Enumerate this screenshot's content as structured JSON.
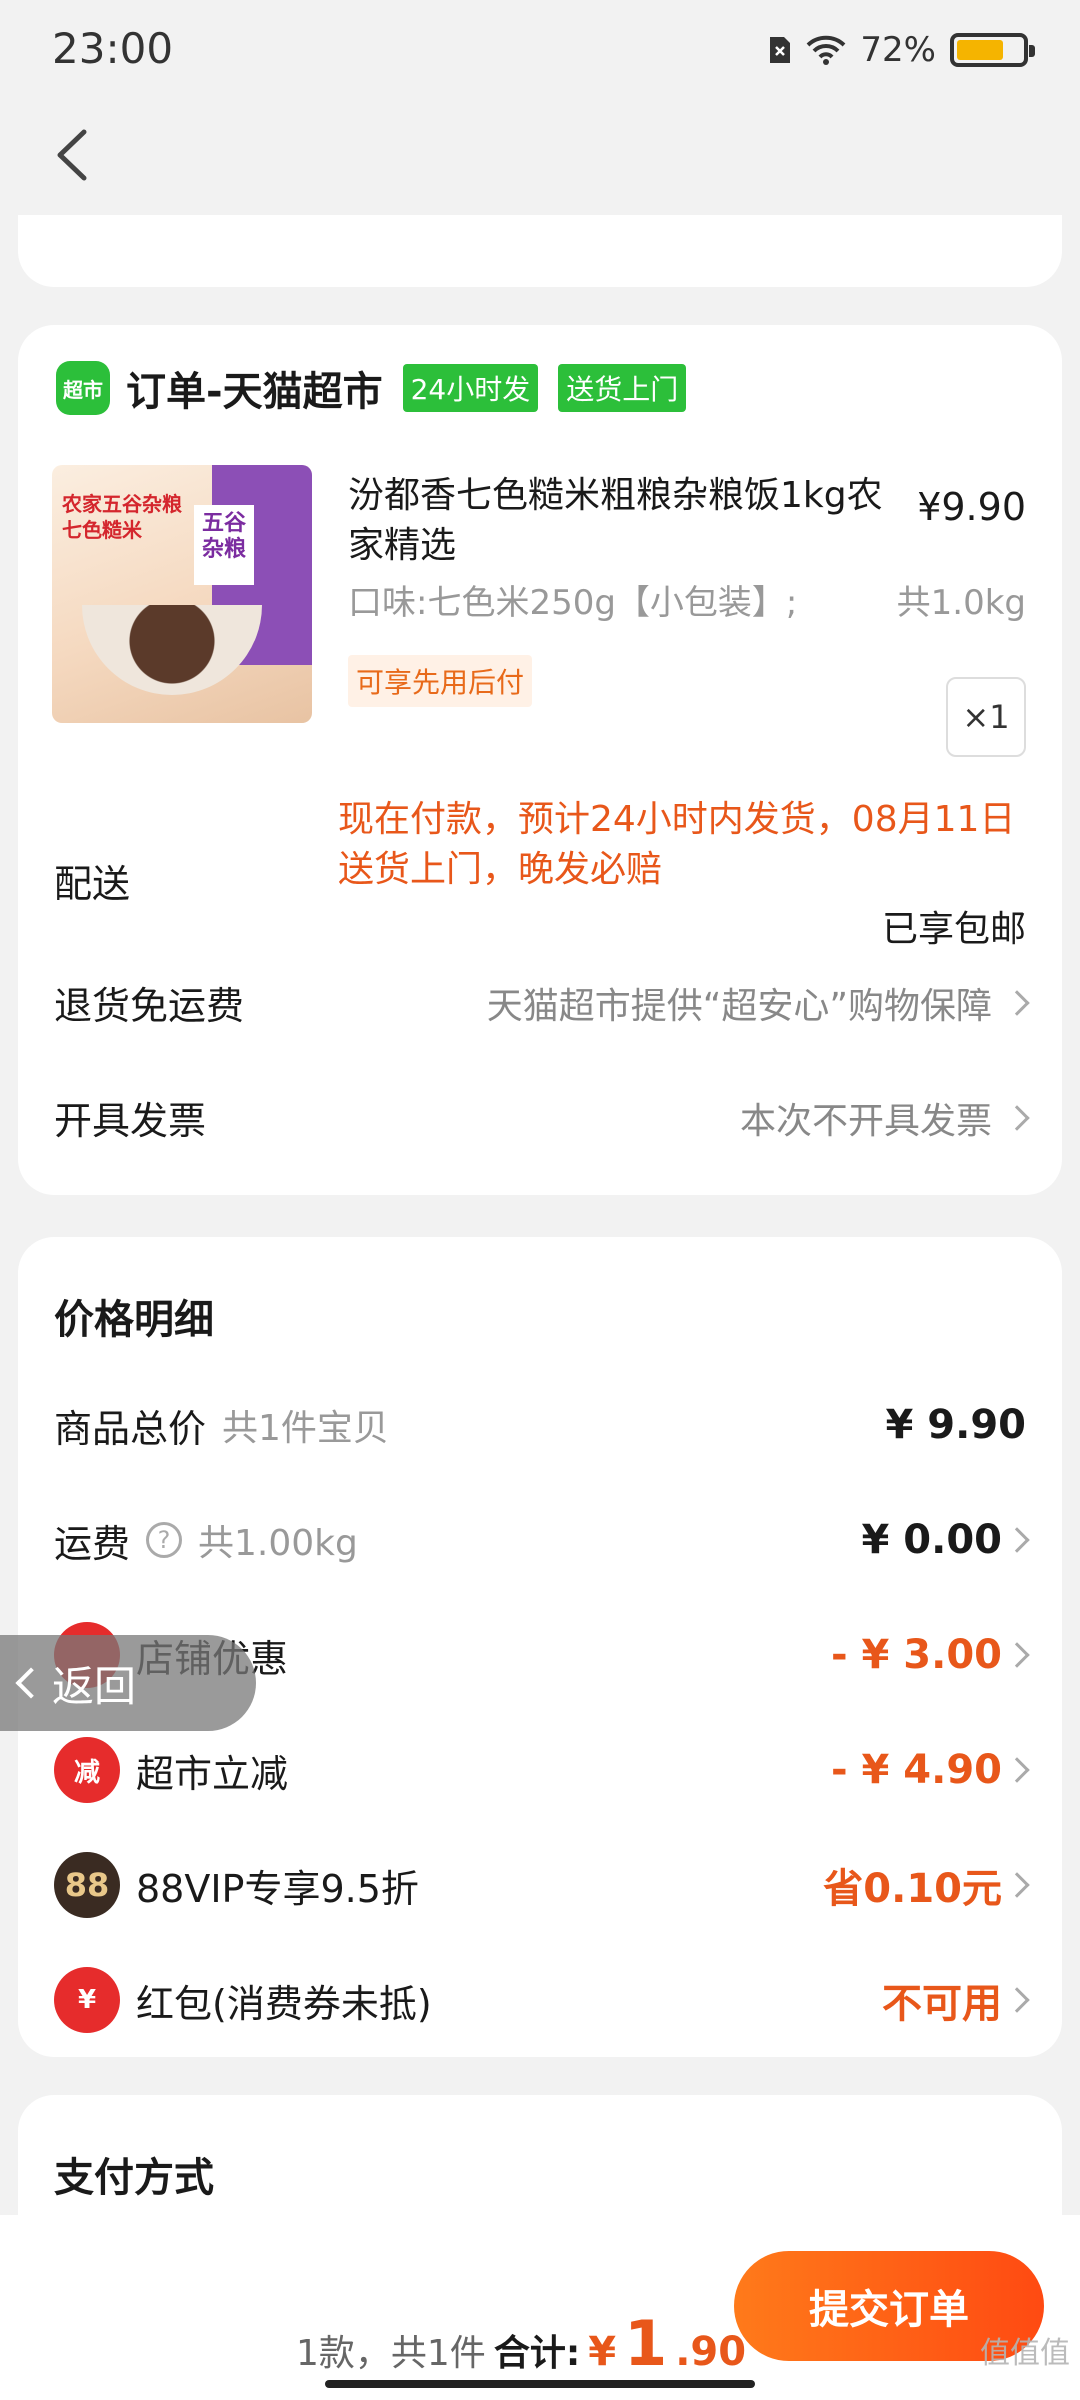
{
  "status_bar": {
    "time": "23:00",
    "battery_percent": "72%",
    "battery_level": 0.72
  },
  "order": {
    "shop_logo": "超市",
    "shop_title": "订单-天猫超市",
    "badges": [
      "24小时发",
      "送货上门"
    ],
    "product": {
      "image_caption": "农家五谷杂粮\n七色糙米",
      "package_text": "五谷\n杂粮",
      "name": "汾都香七色糙米粗粮杂粮饭1kg农家精选",
      "price": "¥9.90",
      "spec": "口味:七色米250g【小包装】;",
      "weight": "共1.0kg",
      "pay_later": "可享先用后付",
      "quantity": "×1"
    },
    "delivery": {
      "label": "配送",
      "text": "现在付款，预计24小时内发货，08月11日送货上门，晚发必赔",
      "free_shipping": "已享包邮"
    },
    "return_row": {
      "label": "退货免运费",
      "value": "天猫超市提供“超安心”购物保障"
    },
    "invoice_row": {
      "label": "开具发票",
      "value": "本次不开具发票"
    }
  },
  "price_detail": {
    "title": "价格明细",
    "total": {
      "label": "商品总价",
      "sub": "共1件宝贝",
      "value": "¥ 9.90"
    },
    "shipping": {
      "label": "运费",
      "sub": "共1.00kg",
      "value": "¥ 0.00"
    },
    "shop_discount": {
      "label": "店铺优惠",
      "value": "- ¥ 3.00"
    },
    "market_cut": {
      "label": "超市立减",
      "icon_text": "减",
      "value": "- ¥ 4.90"
    },
    "vip": {
      "label": "88VIP专享9.5折",
      "icon_text": "88",
      "value": "省0.10元"
    },
    "red_packet": {
      "label": "红包(消费券未抵)",
      "icon_text": "¥",
      "value": "不可用"
    }
  },
  "payment": {
    "title": "支付方式"
  },
  "float_back": {
    "label": "返回"
  },
  "bottom": {
    "count": "1款，共1件",
    "total_label": "合计:",
    "total_yen": "¥",
    "total_int": "1",
    "total_dec": ".90",
    "submit": "提交订单"
  },
  "watermark": "值值值"
}
